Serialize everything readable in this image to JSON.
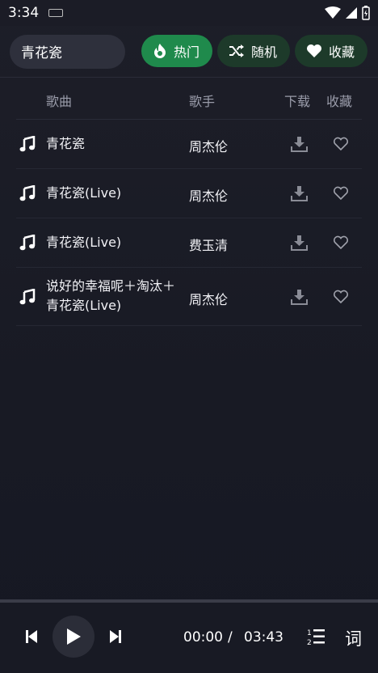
{
  "status_bar": {
    "time": "3:34"
  },
  "search": {
    "value": "青花瓷"
  },
  "chips": {
    "hot": "热门",
    "random": "随机",
    "favorites": "收藏"
  },
  "table": {
    "headers": {
      "song": "歌曲",
      "artist": "歌手",
      "download": "下载",
      "favorite": "收藏"
    },
    "rows": [
      {
        "title": "青花瓷",
        "artist": "周杰伦"
      },
      {
        "title": "青花瓷(Live)",
        "artist": "周杰伦"
      },
      {
        "title": "青花瓷(Live)",
        "artist": "费玉清"
      },
      {
        "title": "说好的幸福呢＋淘汰＋青花瓷(Live)",
        "artist": "周杰伦"
      }
    ]
  },
  "player": {
    "current_time": "00:00",
    "separator": "/",
    "total_time": "03:43",
    "lyrics_label": "词"
  },
  "colors": {
    "accent_green": "#1f8a4c",
    "chip_dark_green": "#1d3a2a",
    "background": "#1b1c26"
  }
}
